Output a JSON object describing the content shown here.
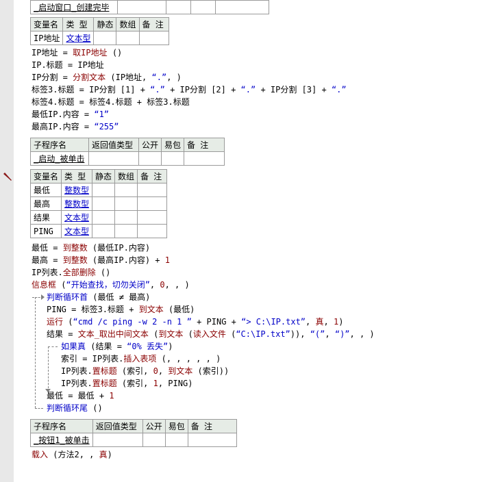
{
  "sub1": {
    "name": "_启动窗口_创建完毕"
  },
  "vars1": {
    "headers": [
      "变量名",
      "类 型",
      "静态",
      "数组",
      "备 注"
    ],
    "rows": [
      {
        "name": "IP地址",
        "type": "文本型"
      }
    ]
  },
  "code1": {
    "l1": {
      "a": "IP地址",
      "b": " = ",
      "c": "取IP地址",
      "d": " ()"
    },
    "l2": {
      "a": "IP.标题 = IP地址"
    },
    "l3": {
      "a": "IP分割 = ",
      "b": "分割文本",
      "c": " (IP地址, ",
      "d": "“.”",
      "e": ", )"
    },
    "l4": {
      "a": "标签3.标题 = IP分割 [1] + ",
      "b": "“.”",
      "c": " + IP分割 [2] + ",
      "d": "“.”",
      "e": " + IP分割 [3] + ",
      "f": "“.”"
    },
    "l5": {
      "a": "标签4.标题 = 标签4.标题 + 标签3.标题"
    },
    "l6": {
      "a": "最低IP.内容 = ",
      "b": "“1”"
    },
    "l7": {
      "a": "最高IP.内容 = ",
      "b": "“255”"
    }
  },
  "subhdr": [
    "子程序名",
    "返回值类型",
    "公开",
    "易包",
    "备 注"
  ],
  "sub2": {
    "name": "_启动_被单击"
  },
  "vars2": {
    "rows": [
      {
        "name": "最低",
        "type": "整数型"
      },
      {
        "name": "最高",
        "type": "整数型"
      },
      {
        "name": "结果",
        "type": "文本型"
      },
      {
        "name": "PING",
        "type": "文本型"
      }
    ]
  },
  "code2": {
    "l1": {
      "a": "最低 = ",
      "b": "到整数",
      "c": " (最低IP.内容)"
    },
    "l2": {
      "a": "最高 = ",
      "b": "到整数",
      "c": " (最高IP.内容) + ",
      "d": "1"
    },
    "l3": {
      "a": "IP列表.",
      "b": "全部删除",
      "c": " ()"
    },
    "l4": {
      "a": "信息框",
      "b": " (",
      "c": "“开始查找，切勿关闭”",
      "d": ", ",
      "e": "0",
      "f": ", , )"
    },
    "l5": {
      "a": "判断循环首",
      "b": " (最低 ≠ 最高)"
    },
    "l6": {
      "a": "PING = 标签3.标题 + ",
      "b": "到文本",
      "c": " (最低)"
    },
    "l7": {
      "a": "运行",
      "b": " (",
      "c": "“cmd /c ping -w 2 -n 1 ”",
      "d": " + PING + ",
      "e": "“> C:\\IP.txt”",
      "f": ", ",
      "g": "真",
      "h": ", ",
      "i": "1",
      "j": ")"
    },
    "l8": {
      "a": "结果 = ",
      "b": "文本_取出中间文本",
      "c": " (",
      "d": "到文本",
      "e": " (",
      "f": "读入文件",
      "g": " (",
      "h": "“C:\\IP.txt”",
      "i": ")), ",
      "j": "“(”",
      "k": ", ",
      "l": "“)”",
      "m": ", , )"
    },
    "l9": {
      "a": "如果真",
      "b": " (结果 = ",
      "c": "“0% 丢失”",
      "d": ")"
    },
    "l10": {
      "a": "索引 = IP列表.",
      "b": "插入表项",
      "c": " (, , , , , )"
    },
    "l11": {
      "a": "IP列表.",
      "b": "置标题",
      "c": " (索引, ",
      "d": "0",
      "e": ", ",
      "f": "到文本",
      "g": " (索引))"
    },
    "l12": {
      "a": "IP列表.",
      "b": "置标题",
      "c": " (索引, ",
      "d": "1",
      "e": ", PING)"
    },
    "l13": {
      "a": "最低 = 最低 + ",
      "b": "1"
    },
    "l14": {
      "a": "判断循环尾",
      "b": " ()"
    }
  },
  "sub3": {
    "name": "_按钮1_被单击"
  },
  "code3": {
    "l1": {
      "a": "载入",
      "b": " (方法2, , ",
      "c": "真",
      "d": ")"
    }
  }
}
